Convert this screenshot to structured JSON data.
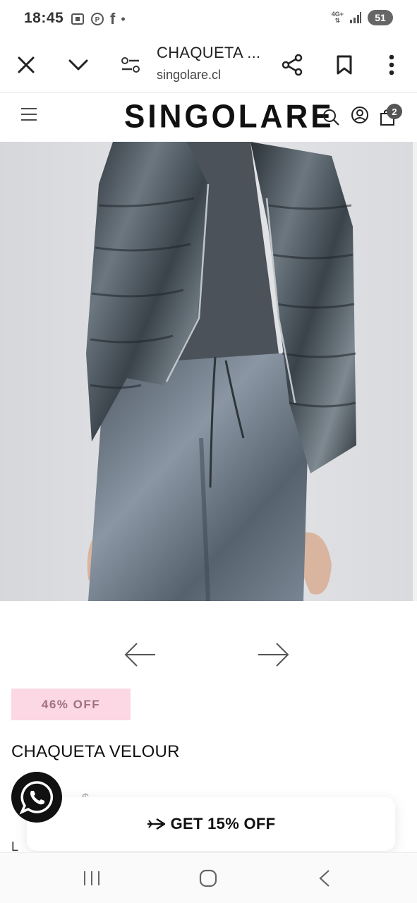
{
  "status_bar": {
    "time": "18:45",
    "network": "4G+",
    "battery": "51",
    "notification_glyph": "f"
  },
  "toolbar": {
    "title": "CHAQUETA ...",
    "url": "singolare.cl"
  },
  "site_header": {
    "logo": "SINGOLARE",
    "cart_count": "2"
  },
  "product": {
    "discount": "46% OFF",
    "title": "CHAQUETA VELOUR",
    "price_partial": "$",
    "old_price_partial": "$ ",
    "size_partial": "L"
  },
  "promo": {
    "label": "GET 15% OFF"
  },
  "colors": {
    "badge_bg": "#fbd8e3",
    "badge_text": "#a0727f",
    "whatsapp_bg": "#111111"
  }
}
